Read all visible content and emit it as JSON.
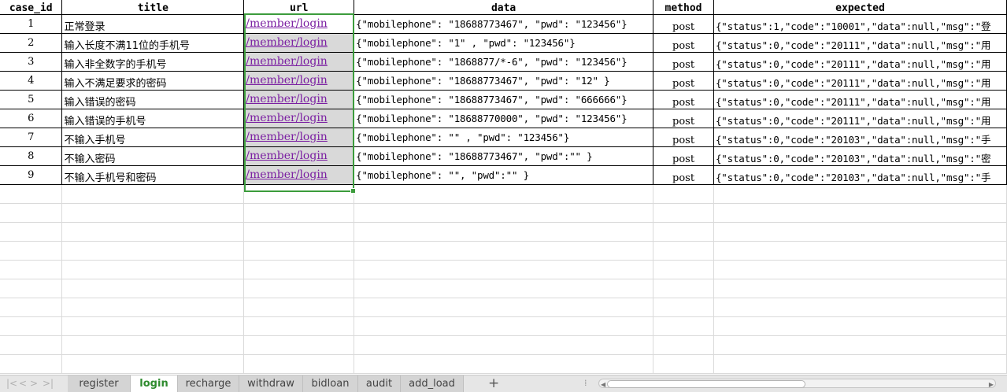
{
  "columns": [
    "case_id",
    "title",
    "url",
    "data",
    "method",
    "expected"
  ],
  "rows": [
    {
      "case_id": "1",
      "title": "正常登录",
      "url": "/member/login",
      "data": "{\"mobilephone\": \"18688773467\", \"pwd\": \"123456\"}",
      "method": "post",
      "expected": "{\"status\":1,\"code\":\"10001\",\"data\":null,\"msg\":\"登"
    },
    {
      "case_id": "2",
      "title": "输入长度不满11位的手机号",
      "url": "/member/login",
      "data": "{\"mobilephone\": \"1\"         , \"pwd\": \"123456\"}",
      "method": "post",
      "expected": "{\"status\":0,\"code\":\"20111\",\"data\":null,\"msg\":\"用"
    },
    {
      "case_id": "3",
      "title": "输入非全数字的手机号",
      "url": "/member/login",
      "data": "{\"mobilephone\": \"1868877/*-6\", \"pwd\": \"123456\"}",
      "method": "post",
      "expected": "{\"status\":0,\"code\":\"20111\",\"data\":null,\"msg\":\"用"
    },
    {
      "case_id": "4",
      "title": "输入不满足要求的密码",
      "url": "/member/login",
      "data": "{\"mobilephone\": \"18688773467\", \"pwd\": \"12\"  }",
      "method": "post",
      "expected": "{\"status\":0,\"code\":\"20111\",\"data\":null,\"msg\":\"用"
    },
    {
      "case_id": "5",
      "title": "输入错误的密码",
      "url": "/member/login",
      "data": "{\"mobilephone\": \"18688773467\", \"pwd\": \"666666\"}",
      "method": "post",
      "expected": "{\"status\":0,\"code\":\"20111\",\"data\":null,\"msg\":\"用"
    },
    {
      "case_id": "6",
      "title": "输入错误的手机号",
      "url": "/member/login",
      "data": "{\"mobilephone\": \"18688770000\", \"pwd\": \"123456\"}",
      "method": "post",
      "expected": "{\"status\":0,\"code\":\"20111\",\"data\":null,\"msg\":\"用"
    },
    {
      "case_id": "7",
      "title": "不输入手机号",
      "url": "/member/login",
      "data": "{\"mobilephone\": \"\"          , \"pwd\": \"123456\"}",
      "method": "post",
      "expected": "{\"status\":0,\"code\":\"20103\",\"data\":null,\"msg\":\"手"
    },
    {
      "case_id": "8",
      "title": "不输入密码",
      "url": "/member/login",
      "data": "{\"mobilephone\": \"18688773467\", \"pwd\":\"\"   }",
      "method": "post",
      "expected": "{\"status\":0,\"code\":\"20103\",\"data\":null,\"msg\":\"密"
    },
    {
      "case_id": "9",
      "title": "不输入手机号和密码",
      "url": "/member/login",
      "data": "{\"mobilephone\": \"\", \"pwd\":\"\"   }",
      "method": "post",
      "expected": "{\"status\":0,\"code\":\"20103\",\"data\":null,\"msg\":\"手"
    }
  ],
  "sheet_tabs": [
    "register",
    "login",
    "recharge",
    "withdraw",
    "bidloan",
    "audit",
    "add_load"
  ],
  "active_tab": "login",
  "icons": {
    "add_sheet": "+",
    "nav_first": "|<",
    "nav_prev": "<",
    "nav_next": ">",
    "nav_last": ">|"
  },
  "colors": {
    "selection_border": "#3c9c3c",
    "link": "#7b1fa2",
    "active_tab_text": "#2e8b2e"
  }
}
